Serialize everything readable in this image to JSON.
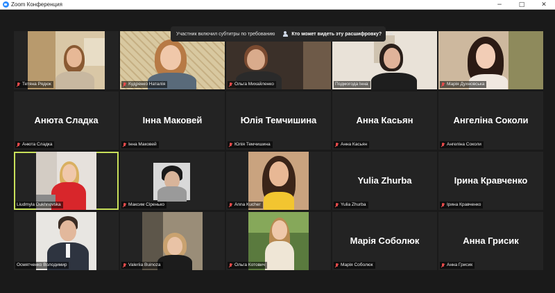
{
  "window": {
    "title": "Zoom Конференция",
    "controls": [
      "−",
      "□",
      "✕"
    ]
  },
  "caption_banner": {
    "text": "Участник включил субтитры по требованию",
    "link_label": "Кто может видеть эту расшифровку?",
    "close": "✕"
  },
  "participants": [
    {
      "name": "Тетяна Рядюк",
      "video": true
    },
    {
      "name": "Кудренко Наталія",
      "video": true
    },
    {
      "name": "Ольга Михайленко",
      "video": true
    },
    {
      "name": "Подмогода Інна",
      "video": true
    },
    {
      "name": "Марія Духновська",
      "video": true
    },
    {
      "name": "Анюта Сладка",
      "video": false,
      "display": "Анюта Сладка"
    },
    {
      "name": "Інна Маковей",
      "video": false,
      "display": "Інна Маковей"
    },
    {
      "name": "Юлія Темчишина",
      "video": false,
      "display": "Юлія Темчишина"
    },
    {
      "name": "Анна Касьян",
      "video": false,
      "display": "Анна Касьян"
    },
    {
      "name": "Ангеліна Соколи",
      "video": false,
      "display": "Ангеліна Соколи"
    },
    {
      "name": "Liudmyla Dukhnovska",
      "video": true,
      "active": true
    },
    {
      "name": "Максим Сіренько",
      "video": true
    },
    {
      "name": "Anna Kucher",
      "video": true
    },
    {
      "name": "Yulia Zhurba",
      "video": false,
      "display": "Yulia Zhurba"
    },
    {
      "name": "Ірина Кравченко",
      "video": false,
      "display": "Ірина Кравченко"
    },
    {
      "name": "Осмятченко Володимир",
      "video": true
    },
    {
      "name": "Valeriia Buinoza",
      "video": true
    },
    {
      "name": "Ольга Котович",
      "video": true
    },
    {
      "name": "Марія Соболюк",
      "video": false,
      "display": "Марія Соболюк"
    },
    {
      "name": "Анна Грисик",
      "video": false,
      "display": "Анна Грисик"
    }
  ],
  "colors": {
    "accent": "#2d8cff",
    "active_speaker": "#c8e05a",
    "muted": "#e84b4b"
  }
}
